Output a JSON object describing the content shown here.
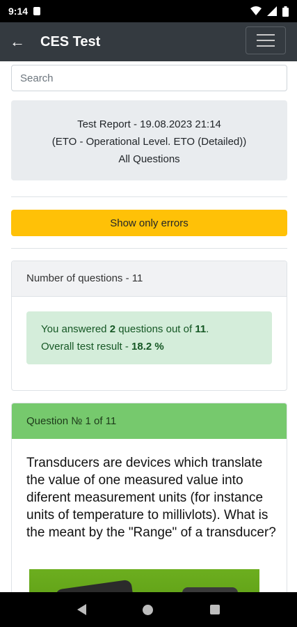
{
  "status_bar": {
    "time": "9:14"
  },
  "app_bar": {
    "title": "CES Test",
    "back_glyph": "←"
  },
  "search": {
    "placeholder": "Search",
    "value": ""
  },
  "report": {
    "line1": "Test Report - 19.08.2023 21:14",
    "line2": "(ETO - Operational Level. ETO (Detailed))",
    "line3": "All Questions"
  },
  "errors_button": {
    "label": "Show only errors",
    "color": "#ffc107"
  },
  "summary": {
    "header": "Number of questions - 11",
    "answered_prefix": "You answered",
    "answered_count": "2",
    "answered_mid": "questions out of",
    "total": "11",
    "answered_suffix": ".",
    "result_prefix": "Overall test result -",
    "result_value": "18.2 %"
  },
  "question": {
    "header": "Question № 1 of 11",
    "text": "Transducers are devices which translate the value of one measured value into diferent measurement units (for instance units of temperature to millivlots). What is the meant by the \"Range\" of a transducer?",
    "header_color": "#76c96d"
  },
  "icons": {
    "status": [
      "sd-card-icon",
      "wifi-icon",
      "signal-icon",
      "battery-icon"
    ],
    "app_bar": [
      "back-arrow-icon",
      "hamburger-menu-icon"
    ],
    "nav": [
      "nav-back-icon",
      "nav-home-icon",
      "nav-recents-icon"
    ]
  }
}
